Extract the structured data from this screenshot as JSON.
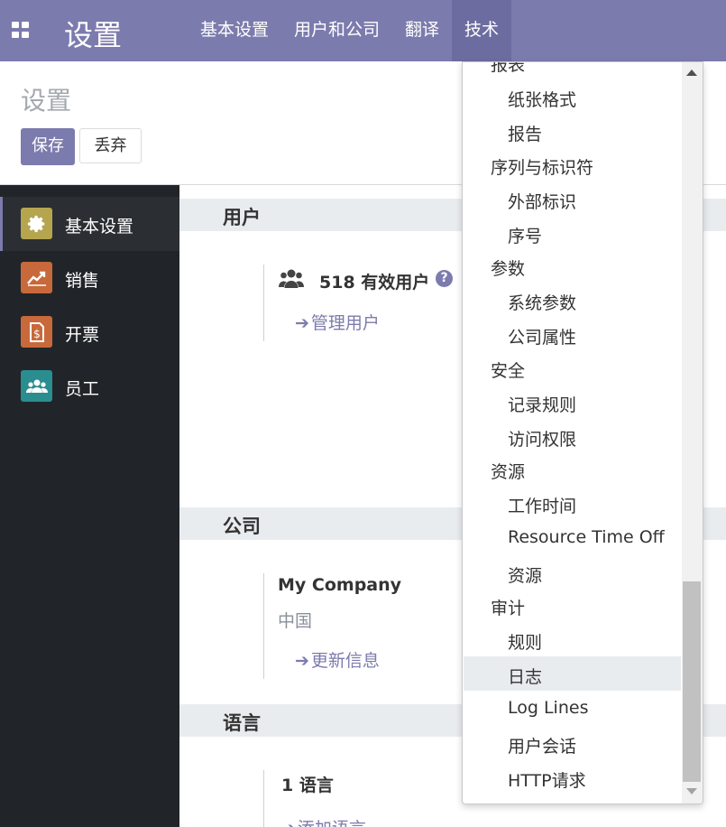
{
  "navbar": {
    "brand": "设置",
    "menu": [
      "基本设置",
      "用户和公司",
      "翻译",
      "技术"
    ],
    "active_index": 3,
    "color": "#7c7bad"
  },
  "control_panel": {
    "title": "设置",
    "save_label": "保存",
    "discard_label": "丢弃"
  },
  "sidebar": {
    "items": [
      {
        "label": "基本设置",
        "icon": "gear-icon",
        "icon_bg": "#b5a54f",
        "active": true
      },
      {
        "label": "销售",
        "icon": "chart-line-icon",
        "icon_bg": "#c8693b",
        "active": false
      },
      {
        "label": "开票",
        "icon": "invoice-icon",
        "icon_bg": "#c8693b",
        "active": false
      },
      {
        "label": "员工",
        "icon": "users-icon",
        "icon_bg": "#2a8d8f",
        "active": false
      }
    ]
  },
  "main": {
    "users": {
      "header": "用户",
      "active_users": "518 有效用户",
      "manage_link": "管理用户"
    },
    "company": {
      "header": "公司",
      "name": "My Company",
      "country": "中国",
      "update_link": "更新信息"
    },
    "languages": {
      "header": "语言",
      "count": "1 语言",
      "add_link": "添加语言"
    }
  },
  "dropdown": {
    "sections": [
      {
        "header": "报表",
        "items": [
          "纸张格式",
          "报告"
        ]
      },
      {
        "header": "序列与标识符",
        "items": [
          "外部标识",
          "序号"
        ]
      },
      {
        "header": "参数",
        "items": [
          "系统参数",
          "公司属性"
        ]
      },
      {
        "header": "安全",
        "items": [
          "记录规则",
          "访问权限"
        ]
      },
      {
        "header": "资源",
        "items": [
          "工作时间",
          "Resource Time Off",
          "资源"
        ]
      },
      {
        "header": "审计",
        "items": [
          "规则",
          "日志",
          "Log Lines",
          "用户会话",
          "HTTP请求"
        ]
      }
    ],
    "hovered_item": "日志"
  }
}
